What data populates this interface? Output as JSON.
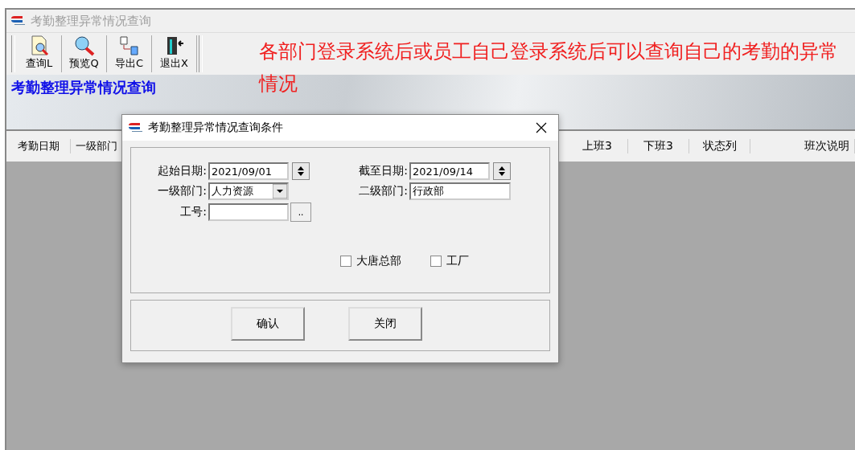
{
  "window": {
    "title": "考勤整理异常情况查询"
  },
  "toolbar": [
    {
      "kind": "query",
      "label": "查询L"
    },
    {
      "kind": "preview",
      "label": "预览Q"
    },
    {
      "kind": "export",
      "label": "导出C"
    },
    {
      "kind": "exit",
      "label": "退出X"
    }
  ],
  "banner": {
    "title": "考勤整理异常情况查询"
  },
  "annotation": "各部门登录系统后或员工自己登录系统后可以查询自己的考勤的异常情况",
  "table": {
    "columns_left": [
      "考勤日期",
      "一级部门"
    ],
    "columns_right": [
      "上班3",
      "下班3",
      "状态列",
      "班次说明"
    ]
  },
  "dialog": {
    "title": "考勤整理异常情况查询条件",
    "start_date": {
      "label": "起始日期:",
      "value": "2021/09/01"
    },
    "end_date": {
      "label": "截至日期:",
      "value": "2021/09/14"
    },
    "dept1": {
      "label": "一级部门:",
      "value": "人力资源"
    },
    "dept2": {
      "label": "二级部门:",
      "value": "行政部"
    },
    "employee_id": {
      "label": "工号:",
      "button": ".."
    },
    "checkboxes": [
      {
        "label": "大唐总部",
        "checked": false
      },
      {
        "label": "工厂",
        "checked": false
      }
    ],
    "buttons": [
      "确认",
      "关闭"
    ]
  }
}
